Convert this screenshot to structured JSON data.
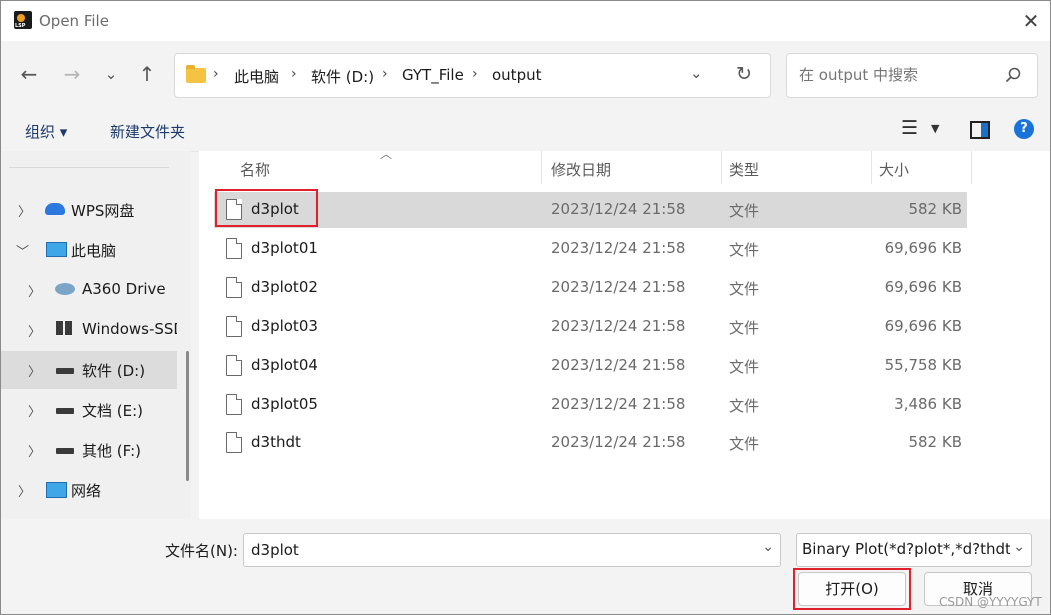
{
  "window": {
    "title": "Open File"
  },
  "address": {
    "crumbs": [
      "此电脑",
      "软件 (D:)",
      "GYT_File",
      "output"
    ]
  },
  "search": {
    "placeholder": "在 output 中搜索"
  },
  "commands": {
    "organize": "组织 ▾",
    "new_folder": "新建文件夹"
  },
  "columns": {
    "name": "名称",
    "date": "修改日期",
    "type": "类型",
    "size": "大小"
  },
  "sidebar": {
    "items": [
      {
        "label": "WPS网盘",
        "icon": "cloud-icon",
        "expanded": false
      },
      {
        "label": "此电脑",
        "icon": "computer-icon",
        "expanded": true
      },
      {
        "label": "A360 Drive",
        "icon": "a360-icon",
        "expanded": false
      },
      {
        "label": "Windows-SSD",
        "icon": "windows-drive-icon",
        "expanded": false
      },
      {
        "label": "软件 (D:)",
        "icon": "drive-icon",
        "expanded": false,
        "selected": true
      },
      {
        "label": "文档 (E:)",
        "icon": "drive-icon",
        "expanded": false
      },
      {
        "label": "其他 (F:)",
        "icon": "drive-icon",
        "expanded": false
      },
      {
        "label": "网络",
        "icon": "network-icon",
        "expanded": false
      }
    ]
  },
  "files": [
    {
      "name": "d3plot",
      "date": "2023/12/24 21:58",
      "type": "文件",
      "size": "582 KB",
      "selected": true
    },
    {
      "name": "d3plot01",
      "date": "2023/12/24 21:58",
      "type": "文件",
      "size": "69,696 KB"
    },
    {
      "name": "d3plot02",
      "date": "2023/12/24 21:58",
      "type": "文件",
      "size": "69,696 KB"
    },
    {
      "name": "d3plot03",
      "date": "2023/12/24 21:58",
      "type": "文件",
      "size": "69,696 KB"
    },
    {
      "name": "d3plot04",
      "date": "2023/12/24 21:58",
      "type": "文件",
      "size": "55,758 KB"
    },
    {
      "name": "d3plot05",
      "date": "2023/12/24 21:58",
      "type": "文件",
      "size": "3,486 KB"
    },
    {
      "name": "d3thdt",
      "date": "2023/12/24 21:58",
      "type": "文件",
      "size": "582 KB"
    }
  ],
  "bottom": {
    "filename_label": "文件名(N):",
    "filename_value": "d3plot",
    "filter": "Binary Plot(*d?plot*,*d?thdt*,",
    "open_label": "打开(O)",
    "cancel_label": "取消"
  },
  "watermark": "CSDN @YYYYGYT",
  "colors": {
    "accent": "#0067c0",
    "highlight_box": "#e0202a",
    "selection": "#d9d9d9"
  }
}
